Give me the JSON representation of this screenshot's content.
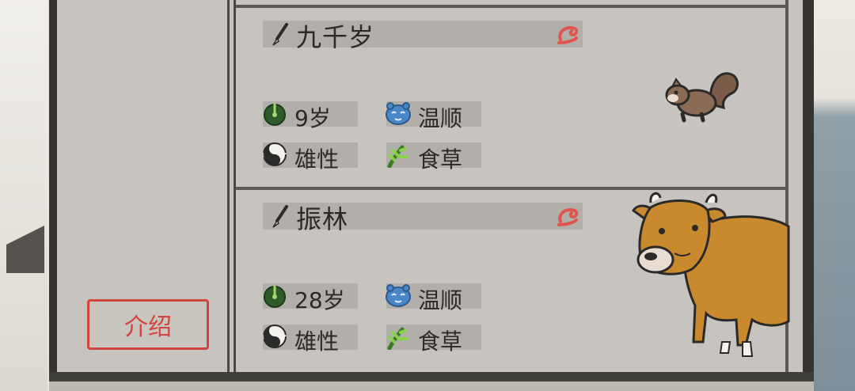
{
  "intro_button": {
    "label": "介绍"
  },
  "animals": [
    {
      "name": "九千岁",
      "age": "9岁",
      "temperament": "温顺",
      "sex": "雄性",
      "diet": "食草",
      "portrait": "squirrel",
      "icons": {
        "name": "brush-icon",
        "favor": "red-swirl-icon",
        "age": "sundial-icon",
        "temperament": "blue-face-icon",
        "sex": "yin-yang-icon",
        "diet": "grass-icon"
      }
    },
    {
      "name": "振林",
      "age": "28岁",
      "temperament": "温顺",
      "sex": "雄性",
      "diet": "食草",
      "portrait": "ox",
      "icons": {
        "name": "brush-icon",
        "favor": "red-swirl-icon",
        "age": "sundial-icon",
        "temperament": "blue-face-icon",
        "sex": "yin-yang-icon",
        "diet": "grass-icon"
      }
    }
  ],
  "colors": {
    "accent_red": "#d2443f",
    "temper_blue": "#4b86c9",
    "age_green": "#2f5a2a",
    "grass_green": "#6ab23a"
  }
}
